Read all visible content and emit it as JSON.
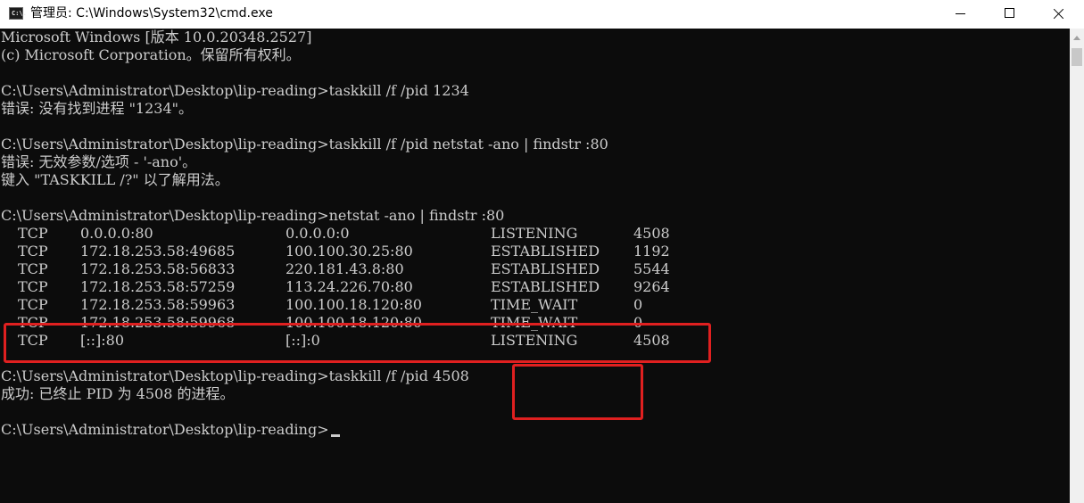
{
  "window": {
    "title": "管理员: C:\\Windows\\System32\\cmd.exe",
    "icon": "cmd-app-icon",
    "icon_text": "C:\\."
  },
  "console": {
    "lines": [
      "Microsoft Windows [版本 10.0.20348.2527]",
      "(c) Microsoft Corporation。保留所有权利。",
      "",
      "C:\\Users\\Administrator\\Desktop\\lip-reading>taskkill /f /pid 1234",
      "错误: 没有找到进程 \"1234\"。",
      "",
      "C:\\Users\\Administrator\\Desktop\\lip-reading>taskkill /f /pid netstat -ano | findstr :80",
      "错误: 无效参数/选项 - '-ano'。",
      "键入 \"TASKKILL /?\" 以了解用法。",
      "",
      "C:\\Users\\Administrator\\Desktop\\lip-reading>netstat -ano | findstr :80"
    ],
    "netstat_rows": [
      {
        "proto": "TCP",
        "local": "0.0.0.0:80",
        "foreign": "0.0.0.0:0",
        "state": "LISTENING",
        "pid": "4508"
      },
      {
        "proto": "TCP",
        "local": "172.18.253.58:49685",
        "foreign": "100.100.30.25:80",
        "state": "ESTABLISHED",
        "pid": "1192"
      },
      {
        "proto": "TCP",
        "local": "172.18.253.58:56833",
        "foreign": "220.181.43.8:80",
        "state": "ESTABLISHED",
        "pid": "5544"
      },
      {
        "proto": "TCP",
        "local": "172.18.253.58:57259",
        "foreign": "113.24.226.70:80",
        "state": "ESTABLISHED",
        "pid": "9264"
      },
      {
        "proto": "TCP",
        "local": "172.18.253.58:59963",
        "foreign": "100.100.18.120:80",
        "state": "TIME_WAIT",
        "pid": "0"
      },
      {
        "proto": "TCP",
        "local": "172.18.253.58:59968",
        "foreign": "100.100.18.120:80",
        "state": "TIME_WAIT",
        "pid": "0"
      },
      {
        "proto": "TCP",
        "local": "[::]:80",
        "foreign": "[::]:0",
        "state": "LISTENING",
        "pid": "4508"
      }
    ],
    "after_lines": [
      "",
      "C:\\Users\\Administrator\\Desktop\\lip-reading>taskkill /f /pid 4508",
      "成功: 已终止 PID 为 4508 的进程。",
      "",
      "C:\\Users\\Administrator\\Desktop\\lip-reading>"
    ]
  },
  "colors": {
    "console_bg": "#0c0c0c",
    "console_text": "#cccccc",
    "highlight": "#e02020"
  }
}
